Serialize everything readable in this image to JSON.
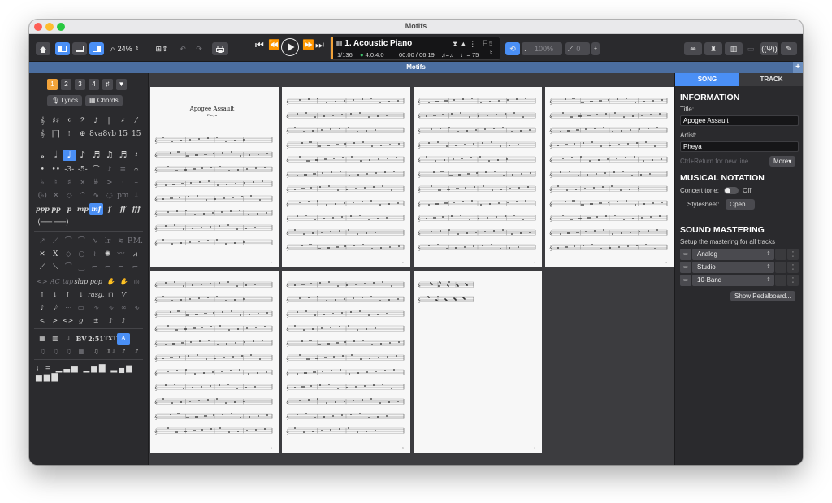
{
  "window": {
    "title": "Motifs"
  },
  "toolbar": {
    "zoom": "24%",
    "track_number_name": "1. Acoustic Piano",
    "bar_position": "1/136",
    "signature": "4.0:4.0",
    "time": "00:00 / 06:19",
    "tempo": "♩= 75",
    "tempo_feel": "♫=♫",
    "key_badge": "F",
    "key_sub": "5",
    "volume": "100%",
    "pan": "0"
  },
  "document_tab": {
    "title": "Motifs"
  },
  "palette": {
    "voices": [
      "1",
      "2",
      "3",
      "4"
    ],
    "lyrics_label": "Lyrics",
    "chords_label": "Chords",
    "text_tools": [
      "BV",
      "2:51",
      "TXT"
    ],
    "dynamics": [
      "ppp",
      "pp",
      "p",
      "mp",
      "mf",
      "f",
      "ff",
      "fff"
    ],
    "techniques": [
      "tap",
      "slap",
      "pop"
    ],
    "rasg": "rasg."
  },
  "score": {
    "song_title": "Apogee Assault",
    "artist": "Pheya"
  },
  "inspector": {
    "tabs": [
      "SONG",
      "TRACK"
    ],
    "information_heading": "INFORMATION",
    "title_label": "Title:",
    "title_value": "Apogee Assault",
    "artist_label": "Artist:",
    "artist_value": "Pheya",
    "hint": "Ctrl+Return for new line.",
    "more_label": "More▾",
    "notation_heading": "MUSICAL NOTATION",
    "concert_tone_label": "Concert tone:",
    "concert_tone_state": "Off",
    "stylesheet_label": "Stylesheet:",
    "stylesheet_button": "Open...",
    "mastering_heading": "SOUND MASTERING",
    "mastering_desc": "Setup the mastering for all tracks",
    "mastering": [
      "Analog",
      "Studio",
      "10-Band"
    ],
    "pedalboard_button": "Show Pedalboard..."
  },
  "colors": {
    "accent": "#4a8ff5",
    "voice_active": "#f2a33a",
    "tab_bar": "#4b6ea0"
  }
}
